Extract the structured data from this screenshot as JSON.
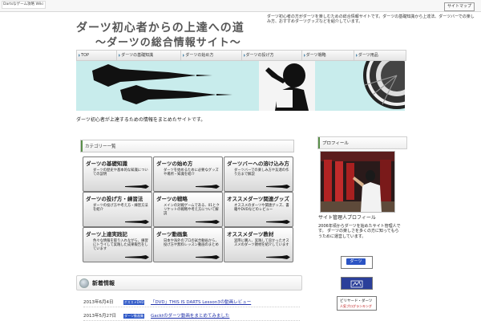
{
  "topbar": {
    "brand": "Dartsなゲーム攻略 Wiki",
    "corner_link": "サイトマップ"
  },
  "header": {
    "title_line1": "ダーツ初心者からの上達への道",
    "title_line2": "～ダーツの総合情報サイト～",
    "description": "ダーツ初心者の方がダーツを楽しむための総合情報サイトです。ダーツの基礎知識から上達法、ダーツバーでの楽しみ方、おすすめダーツグッズなどを紹介しています。"
  },
  "nav": {
    "items": [
      "TOP",
      "ダーツの基礎知識",
      "ダーツの始め方",
      "ダーツの投げ方",
      "ダーツ戦略",
      "ダーツ用品"
    ]
  },
  "intro": {
    "text": "ダーツ初心者が上達するための情報をまとめたサイトです。"
  },
  "category_section": {
    "header": "カテゴリー一覧",
    "cards": [
      {
        "title": "ダーツの基礎知識",
        "desc": "ダーツの歴史や基本的な知識についての説明"
      },
      {
        "title": "ダーツの始め方",
        "desc": "ダーツを始めるために必要なグッズや場所・知識を紹介"
      },
      {
        "title": "ダーツバーへの溶け込み方",
        "desc": "ダーツバーでの楽しみ方や友達の作り方まで解説"
      },
      {
        "title": "ダーツの投げ方・練習法",
        "desc": "ダーツの投げ方や考え方・練習方法を紹介"
      },
      {
        "title": "ダーツの戦略",
        "desc": "メインの対戦ゲームである、01とクリケットの戦略や考え方について解説"
      },
      {
        "title": "オススメダーツ関連グッズ",
        "desc": "オススメのダーツや関連グッズ、書籍やDVDなどのレビュー"
      },
      {
        "title": "ダーツ上達実践記",
        "desc": "色々な情報を取り入れながら、練習にトライして実践した成果報告をしています"
      },
      {
        "title": "ダーツ動画集",
        "desc": "日本や海外のプロの試合動画から、投げ方や無料レッスン動画のまとめ"
      },
      {
        "title": "オススメダーツ教材",
        "desc": "実際に購入、実践して良かったオススメのダーツ教材を紹介しています"
      }
    ]
  },
  "news": {
    "header": "新着情報",
    "items": [
      {
        "date": "2013年6月4日",
        "tag": "オススメDVD",
        "title": "「DVD」THIS IS DARTS Lesson3の動画レビュー"
      },
      {
        "date": "2013年5月27日",
        "tag": "ダーツ動画集",
        "title": "Gacktのダーツ動画をまとめてみました"
      }
    ]
  },
  "sidebar": {
    "profile_header": "プロフィール",
    "profile_name": "サイト管理人プロフィール",
    "profile_bio": "2006年頃からダーツを始めたサイト管理人です。 ダーツの楽しさを多くの方に知ってもらうために運営しています。",
    "banner_darts_label": "ダーツ",
    "banner_billiards_line1": "ビリヤード・ダーツ",
    "banner_billiards_line2": "人気ブログランキング"
  },
  "colors": {
    "hero_bg": "#c8ecec",
    "nav_marker": "#5b8fb0",
    "section_bar": "#5a8f4a",
    "news_tag_bg": "#2e58c7",
    "link": "#2233aa"
  }
}
